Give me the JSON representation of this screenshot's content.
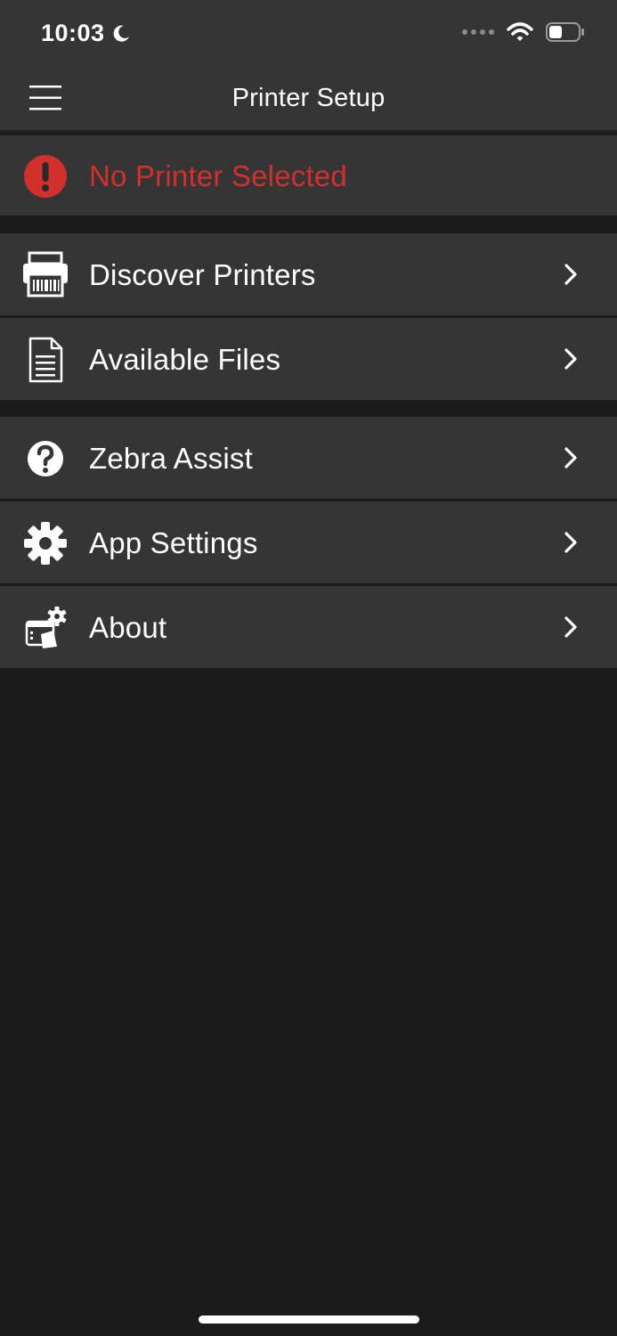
{
  "status_bar": {
    "time": "10:03"
  },
  "nav": {
    "title": "Printer Setup"
  },
  "alert": {
    "text": "No Printer Selected",
    "color": "#d2302c"
  },
  "menu": {
    "items": [
      {
        "label": "Discover Printers",
        "icon": "printer-icon"
      },
      {
        "label": "Available Files",
        "icon": "document-icon"
      },
      {
        "label": "Zebra Assist",
        "icon": "help-icon"
      },
      {
        "label": "App Settings",
        "icon": "gear-icon"
      },
      {
        "label": "About",
        "icon": "about-icon"
      }
    ]
  },
  "colors": {
    "background": "#1b1b1b",
    "row": "#353535",
    "alert_red": "#d2302c"
  }
}
